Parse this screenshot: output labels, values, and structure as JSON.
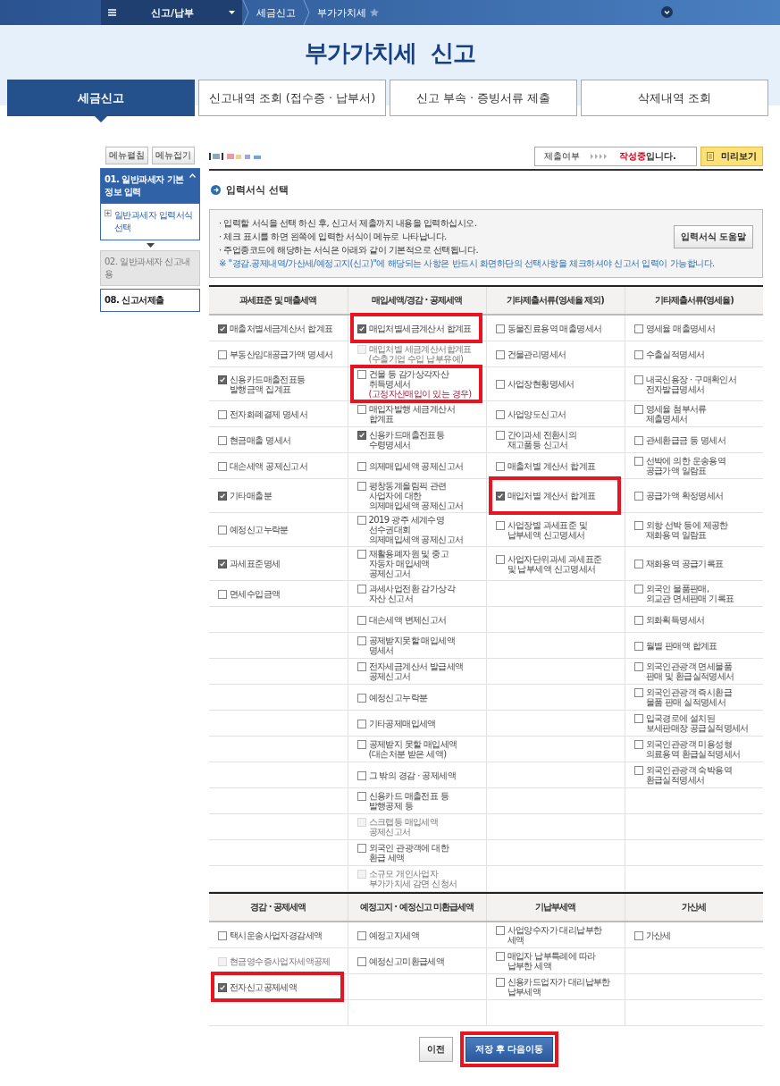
{
  "top_nav": {
    "menu": "신고/납부",
    "breadcrumbs": [
      "세금신고",
      "부가가치세"
    ]
  },
  "page_title": "부가가치세  신고",
  "tabs": [
    {
      "label": "세금신고",
      "selected": true
    },
    {
      "label": "신고내역 조회 (접수증 · 납부서)",
      "selected": false
    },
    {
      "label": "신고 부속 · 증빙서류 제출",
      "selected": false
    },
    {
      "label": "삭제내역 조회",
      "selected": false
    }
  ],
  "sidebar": {
    "buttons": [
      "메뉴펼침",
      "메뉴접기"
    ],
    "items": [
      {
        "label": "01. 일반과세자 기본정보 입력",
        "selected": true,
        "expanded": true,
        "disabled": false,
        "children": [
          {
            "label": "일반과세자 입력서식 선택"
          }
        ]
      },
      {
        "label": "02. 일반과세자 신고내용",
        "selected": false,
        "expanded": false,
        "disabled": true
      },
      {
        "label": "08. 신고서제출",
        "selected": false,
        "expanded": false,
        "disabled": false
      }
    ]
  },
  "status": {
    "label": "제출여부",
    "value": "작성중",
    "suffix": "입니다."
  },
  "preview_button": "미리보기",
  "section_title": "입력서식 선택",
  "info": {
    "bullets": [
      "· 입력할 서식을 선택 하신 후, 신고서 제출까지 내용을 입력하십시오.",
      "· 체크 표시를 하면 왼쪽에 입력한 서식이 메뉴로 나타납니다.",
      "· 주업종코드에 해당하는 서식은 아래와 같이 기본적으로 선택됩니다."
    ],
    "note": "※ \"경감.공제내역/가산세/예정고지(신고)\"에 해당되는 사항은 반드시 화면하단의 선택사항을 체크하셔야 신고서 입력이 가능합니다.",
    "help_button": "입력서식 도움말"
  },
  "tables": [
    {
      "columns": [
        "과세표준 및 매출세액",
        "매입세액/경감 · 공제세액",
        "기타제출서류(영세율 제외)",
        "기타제출서류(영세율)"
      ],
      "rows": [
        [
          {
            "lines": [
              "매출처별세금계산서 합계표"
            ],
            "checked": true,
            "disabled": false,
            "highlighted": false
          },
          {
            "lines": [
              "매입처별세금계산서 합계표"
            ],
            "checked": true,
            "disabled": false,
            "highlighted": true
          },
          {
            "lines": [
              "동물진료용역 매출명세서"
            ],
            "checked": false,
            "disabled": false,
            "highlighted": false
          },
          {
            "lines": [
              "영세율 매출명세서"
            ],
            "checked": false,
            "disabled": false,
            "highlighted": false
          }
        ],
        [
          {
            "lines": [
              "부동산임대공급가액 명세서"
            ],
            "checked": false,
            "disabled": false,
            "highlighted": false
          },
          {
            "lines": [
              "매입처별 세금계산서합계표",
              "(수출기업 수입 납부유예)"
            ],
            "checked": false,
            "disabled": true,
            "highlighted": false
          },
          {
            "lines": [
              "건물관리명세서"
            ],
            "checked": false,
            "disabled": false,
            "highlighted": false
          },
          {
            "lines": [
              "수출실적명세서"
            ],
            "checked": false,
            "disabled": false,
            "highlighted": false
          }
        ],
        [
          {
            "lines": [
              "신용카드매출전표등",
              "발행금액 집계표"
            ],
            "checked": true,
            "disabled": false,
            "highlighted": false
          },
          {
            "lines": [
              "건물 등 감가상각자산",
              "취득명세서"
            ],
            "note": "(고정자산매입이 있는 경우)",
            "checked": false,
            "disabled": false,
            "highlighted": true
          },
          {
            "lines": [
              "사업장현황명세서"
            ],
            "checked": false,
            "disabled": false,
            "highlighted": false
          },
          {
            "lines": [
              "내국신용장 · 구매확인서",
              "전자발급명세서"
            ],
            "checked": false,
            "disabled": false,
            "highlighted": false
          }
        ],
        [
          {
            "lines": [
              "전자화폐결제 명세서"
            ],
            "checked": false,
            "disabled": false,
            "highlighted": false
          },
          {
            "lines": [
              "매입자발행 세금계산서",
              "합계표"
            ],
            "checked": false,
            "disabled": false,
            "highlighted": false
          },
          {
            "lines": [
              "사업양도신고서"
            ],
            "checked": false,
            "disabled": false,
            "highlighted": false
          },
          {
            "lines": [
              "영세율 첨부서류",
              "제출명세서"
            ],
            "checked": false,
            "disabled": false,
            "highlighted": false
          }
        ],
        [
          {
            "lines": [
              "현금매출 명세서"
            ],
            "checked": false,
            "disabled": false,
            "highlighted": false
          },
          {
            "lines": [
              "신용카드매출전표등",
              "수령명세서"
            ],
            "checked": true,
            "disabled": false,
            "highlighted": false
          },
          {
            "lines": [
              "간이과세 전환시의",
              "재고품등 신고서"
            ],
            "checked": false,
            "disabled": false,
            "highlighted": false
          },
          {
            "lines": [
              "관세환급금 등 명세서"
            ],
            "checked": false,
            "disabled": false,
            "highlighted": false
          }
        ],
        [
          {
            "lines": [
              "대손세액 공제신고서"
            ],
            "checked": false,
            "disabled": false,
            "highlighted": false
          },
          {
            "lines": [
              "의제매입세액 공제신고서"
            ],
            "checked": false,
            "disabled": false,
            "highlighted": false
          },
          {
            "lines": [
              "매출처별 계산서 합계표"
            ],
            "checked": false,
            "disabled": false,
            "highlighted": false
          },
          {
            "lines": [
              "선박에 의한 운송용역",
              "공급가액 일람표"
            ],
            "checked": false,
            "disabled": false,
            "highlighted": false
          }
        ],
        [
          {
            "lines": [
              "기타매출분"
            ],
            "checked": true,
            "disabled": false,
            "highlighted": false
          },
          {
            "lines": [
              "평창동계올림픽 관련",
              "사업자에 대한",
              "의제매입세액 공제신고서"
            ],
            "checked": false,
            "disabled": false,
            "highlighted": false
          },
          {
            "lines": [
              "매입처별 계산서 합계표"
            ],
            "checked": true,
            "disabled": false,
            "highlighted": true
          },
          {
            "lines": [
              "공급가액 확정명세서"
            ],
            "checked": false,
            "disabled": false,
            "highlighted": false
          }
        ],
        [
          {
            "lines": [
              "예정신고누락분"
            ],
            "checked": false,
            "disabled": false,
            "highlighted": false
          },
          {
            "lines": [
              "2019 광주 세계수영",
              "선수권대회",
              "의제매입세액 공제신고서"
            ],
            "checked": false,
            "disabled": false,
            "highlighted": false
          },
          {
            "lines": [
              "사업장별 과세표준 및",
              "납부세액 신고명세서"
            ],
            "checked": false,
            "disabled": false,
            "highlighted": false
          },
          {
            "lines": [
              "외항 선박 등에 제공한",
              "재화용역 일람표"
            ],
            "checked": false,
            "disabled": false,
            "highlighted": false
          }
        ],
        [
          {
            "lines": [
              "과세표준명세"
            ],
            "checked": true,
            "disabled": false,
            "highlighted": false
          },
          {
            "lines": [
              "재활용폐자원 및 중고",
              "자동차 매입세액",
              "공제신고서"
            ],
            "checked": false,
            "disabled": false,
            "highlighted": false
          },
          {
            "lines": [
              "사업자단위과세 과세표준",
              "및 납부세액 신고명세서"
            ],
            "checked": false,
            "disabled": false,
            "highlighted": false
          },
          {
            "lines": [
              "재화용역 공급기록표"
            ],
            "checked": false,
            "disabled": false,
            "highlighted": false
          }
        ],
        [
          {
            "lines": [
              "면세수입금액"
            ],
            "checked": false,
            "disabled": false,
            "highlighted": false
          },
          {
            "lines": [
              "과세사업전환 감가상각",
              "자산 신고서"
            ],
            "checked": false,
            "disabled": false,
            "highlighted": false
          },
          null,
          {
            "lines": [
              "외국인 물품판매,",
              "외교관 면세판매 기록표"
            ],
            "checked": false,
            "disabled": false,
            "highlighted": false
          }
        ],
        [
          null,
          {
            "lines": [
              "대손세액 변제신고서"
            ],
            "checked": false,
            "disabled": false,
            "highlighted": false
          },
          null,
          {
            "lines": [
              "외화획득명세서"
            ],
            "checked": false,
            "disabled": false,
            "highlighted": false
          }
        ],
        [
          null,
          {
            "lines": [
              "공제받지못할 매입세액",
              "명세서"
            ],
            "checked": false,
            "disabled": false,
            "highlighted": false
          },
          null,
          {
            "lines": [
              "월별 판매액 합계표"
            ],
            "checked": false,
            "disabled": false,
            "highlighted": false
          }
        ],
        [
          null,
          {
            "lines": [
              "전자세금계산서 발급세액",
              "공제신고서"
            ],
            "checked": false,
            "disabled": false,
            "highlighted": false
          },
          null,
          {
            "lines": [
              "외국인관광객 면세물품",
              "판매 및 환급실적명세서"
            ],
            "checked": false,
            "disabled": false,
            "highlighted": false
          }
        ],
        [
          null,
          {
            "lines": [
              "예정신고누락분"
            ],
            "checked": false,
            "disabled": false,
            "highlighted": false
          },
          null,
          {
            "lines": [
              "외국인관광객 즉시환급",
              "물품 판매 실적명세서"
            ],
            "checked": false,
            "disabled": false,
            "highlighted": false
          }
        ],
        [
          null,
          {
            "lines": [
              "기타공제매입세액"
            ],
            "checked": false,
            "disabled": false,
            "highlighted": false
          },
          null,
          {
            "lines": [
              "입국경로에 설치된",
              "보세판매장 공급실적명세서"
            ],
            "checked": false,
            "disabled": false,
            "highlighted": false
          }
        ],
        [
          null,
          {
            "lines": [
              "공제받지 못할 매입세액",
              "(대손처분 받은 세액)"
            ],
            "checked": false,
            "disabled": false,
            "highlighted": false
          },
          null,
          {
            "lines": [
              "외국인관광객 미용성형",
              "의료용역 환급실적명세서"
            ],
            "checked": false,
            "disabled": false,
            "highlighted": false
          }
        ],
        [
          null,
          {
            "lines": [
              "그 밖의 경감 · 공제세액"
            ],
            "checked": false,
            "disabled": false,
            "highlighted": false
          },
          null,
          {
            "lines": [
              "외국인관광객 숙박용역",
              "환급실적명세서"
            ],
            "checked": false,
            "disabled": false,
            "highlighted": false
          }
        ],
        [
          null,
          {
            "lines": [
              "신용카드 매출전표 등",
              "발행공제 등"
            ],
            "checked": false,
            "disabled": false,
            "highlighted": false
          },
          null,
          null
        ],
        [
          null,
          {
            "lines": [
              "스크랩등 매입세액",
              "공제신고서"
            ],
            "checked": false,
            "disabled": true,
            "highlighted": false
          },
          null,
          null
        ],
        [
          null,
          {
            "lines": [
              "외국인 관광객에 대한",
              "환급 세액"
            ],
            "checked": false,
            "disabled": false,
            "highlighted": false
          },
          null,
          null
        ],
        [
          null,
          {
            "lines": [
              "소규모 개인사업자",
              "부가가치세 감면 신청서"
            ],
            "checked": false,
            "disabled": true,
            "highlighted": false
          },
          null,
          null
        ]
      ]
    },
    {
      "columns": [
        "경감 · 공제세액",
        "예정고지 · 예정신고 미환급세액",
        "기납부세액",
        "가산세"
      ],
      "rows": [
        [
          {
            "lines": [
              "택시운송사업자경감세액"
            ],
            "checked": false,
            "disabled": false,
            "highlighted": false
          },
          {
            "lines": [
              "예정고지세액"
            ],
            "checked": false,
            "disabled": false,
            "highlighted": false
          },
          {
            "lines": [
              "사업양수자가 대리납부한",
              "세액"
            ],
            "checked": false,
            "disabled": false,
            "highlighted": false
          },
          {
            "lines": [
              "가산세"
            ],
            "checked": false,
            "disabled": false,
            "highlighted": false
          }
        ],
        [
          {
            "lines": [
              "현금영수증사업자세액공제"
            ],
            "checked": false,
            "disabled": true,
            "highlighted": false
          },
          {
            "lines": [
              "예정신고미환급세액"
            ],
            "checked": false,
            "disabled": false,
            "highlighted": false
          },
          {
            "lines": [
              "매입자 납부특례에 따라",
              "납부한 세액"
            ],
            "checked": false,
            "disabled": false,
            "highlighted": false
          },
          null
        ],
        [
          {
            "lines": [
              "전자신고공제세액"
            ],
            "checked": true,
            "disabled": false,
            "highlighted": true
          },
          null,
          {
            "lines": [
              "신용카드업자가 대리납부한",
              "납부세액"
            ],
            "checked": false,
            "disabled": false,
            "highlighted": false
          },
          null
        ],
        [
          null,
          null,
          null,
          null
        ]
      ]
    }
  ],
  "buttons": [
    {
      "label": "이전",
      "kind": "secondary",
      "highlighted": false
    },
    {
      "label": "저장 후 다음이동",
      "kind": "primary",
      "highlighted": true
    }
  ]
}
